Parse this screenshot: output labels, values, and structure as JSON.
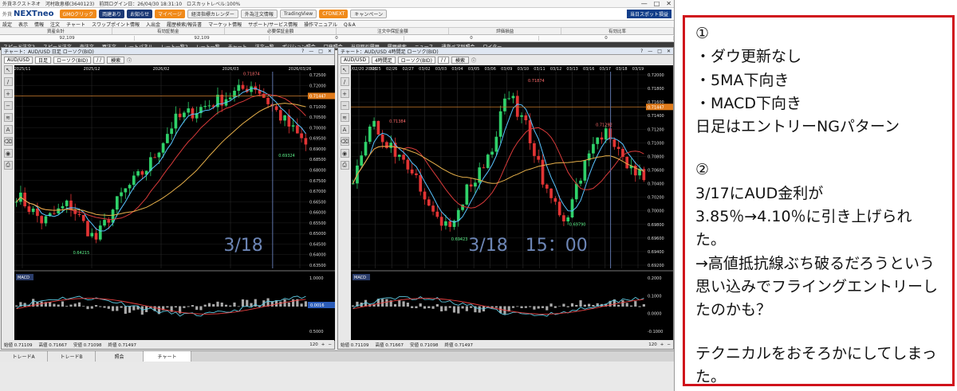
{
  "app": {
    "title": "外貨ネクストネオ",
    "account": "河村政恵様(3640123)",
    "last_login": "前回ログイン日：26/04/30 18:31:10",
    "loss_cut": "ロスカットレベル:100%",
    "brand_small": "外貨",
    "brand": "NEXTneo",
    "toolbar_buttons": [
      "GMOクリック",
      "両建あり",
      "お知らせ",
      "マイページ",
      "経済指標カレンダー",
      "外為注文情報",
      "TradingView",
      "CFDNEXT",
      "キャンペーン"
    ],
    "spot_button": "当日スポット損益",
    "window_controls": [
      "—",
      "□",
      "✕"
    ]
  },
  "menu": [
    "設定",
    "表示",
    "情報",
    "注文",
    "チャート",
    "スワップポイント情報",
    "入出金",
    "履歴検索/報告書",
    "マーケット情報",
    "サポート/サービス情報",
    "操作マニュアル",
    "Q＆A"
  ],
  "balances": {
    "labels": [
      "資産合計",
      "有効証拠金",
      "必要保証金額",
      "注文中保証金額",
      "評価損益",
      "有効比率"
    ],
    "values": [
      "92,109",
      "92,109",
      "0",
      "0",
      "0"
    ]
  },
  "toolbar2": [
    "スピード注文2",
    "スピード注文",
    "売注文",
    "買注文",
    "レートパネル",
    "レート一覧2",
    "レート一覧",
    "チャート",
    "注文一覧",
    "ポジション照会",
    "口座照会",
    "当日取引履歴",
    "履歴検索",
    "ニュース",
    "通貨ペア別照会",
    "ロイター"
  ],
  "left_chart": {
    "title": "チャート：AUD/USD 日足 ローソク(BID)",
    "pair": "AUD/USD",
    "period": "日足",
    "type": "ローソク(BID)",
    "date_field": "/ /",
    "search": "検索",
    "x_labels": [
      "2025/11",
      "2025/12",
      "2026/02",
      "2026/03",
      "2026/03/26"
    ],
    "y_labels": [
      "0.72500",
      "0.72000",
      "0.71500",
      "0.71000",
      "0.70500",
      "0.70000",
      "0.69500",
      "0.69000",
      "0.68500",
      "0.68000",
      "0.67500",
      "0.67000",
      "0.66500",
      "0.66000",
      "0.65500",
      "0.65000",
      "0.64500",
      "0.64000",
      "0.63500"
    ],
    "price_tag": "0.71447",
    "high_label": "0.71874",
    "low_label": "0.64215",
    "low2_label": "0.69324",
    "overlay": "3/18",
    "macd_label": "MACD",
    "macd_y_labels": [
      "1.0000",
      "0.5000"
    ],
    "macd_tag": "0.0016",
    "footer": [
      "始値 0.71109",
      "高値 0.71667",
      "安値 0.71098",
      "終値 0.71497"
    ],
    "zoom": "120",
    "scroll_start": "26/05/19/0000"
  },
  "right_chart": {
    "title": "チャート：AUD/USD 4時間足 ローソク(BID)",
    "pair": "AUD/USD",
    "period": "4時間足",
    "type": "ローソク(BID)",
    "date_field": "/ /",
    "search": "検索",
    "x_labels": [
      "2026/02/20 20:00",
      "02/25",
      "02/26",
      "02/27",
      "03/02",
      "03/03",
      "03/04",
      "03/05",
      "03/06",
      "03/09",
      "03/10",
      "03/11",
      "03/12",
      "03/13",
      "03/16",
      "03/17",
      "03/18",
      "03/19"
    ],
    "y_labels": [
      "0.72000",
      "0.71800",
      "0.71600",
      "0.71400",
      "0.71200",
      "0.71000",
      "0.70800",
      "0.70600",
      "0.70400",
      "0.70200",
      "0.70000",
      "0.69800",
      "0.69600",
      "0.69400",
      "0.69200"
    ],
    "price_tag": "0.71447",
    "labels": [
      "0.71384",
      "0.71874",
      "0.71292",
      "0.69423",
      "0.69790"
    ],
    "overlay": "3/18　15：00",
    "macd_label": "MACD",
    "macd_y_labels": [
      "0.2000",
      "0.1000",
      "0.0000",
      "-0.1000"
    ],
    "footer": [
      "始値 0.71109",
      "高値 0.71667",
      "安値 0.71098",
      "終値 0.71497"
    ],
    "zoom": "120"
  },
  "bottom_tabs": [
    "トレードA",
    "トレードB",
    "照会",
    "チャート"
  ],
  "note": {
    "section1": "①\n・ダウ更新なし\n・5MA下向き\n・MACD下向き\n日足はエントリーNGパターン",
    "section2": "②\n3/17にAUD金利が\n3.85％→4.10％に引き上げられた。\n→高値抵抗線ぶち破るだろうという思い込みでフライングエントリーしたのかも？",
    "section3": "テクニカルをおそろかにしてしまった。"
  },
  "colors": {
    "note_border": "#d0121b",
    "overlay_text": "#6d86b6",
    "bull": "#2fd16a",
    "bear": "#e23434",
    "ma_fast": "#58c3ff",
    "ma_mid": "#d83a3a",
    "ma_slow": "#e7b04a",
    "resistance": "#c87a2a"
  }
}
